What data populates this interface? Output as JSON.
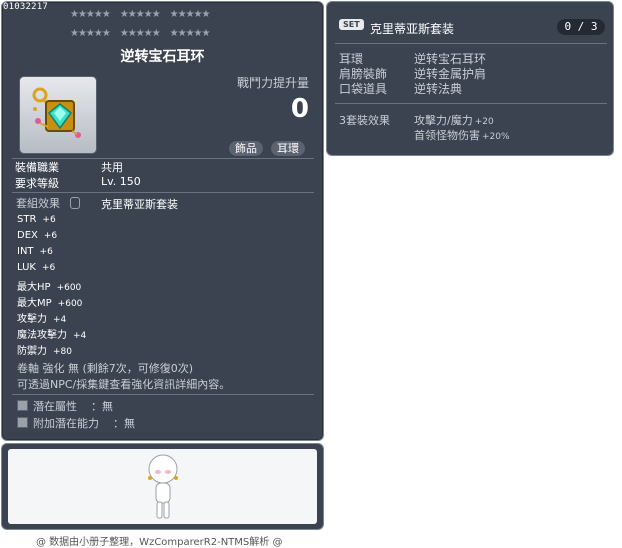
{
  "item": {
    "id": "01032217",
    "stars_top": [
      "★★★★★",
      "★★★★★",
      "★★★★★"
    ],
    "stars_bottom": [
      "★★★★★",
      "★★★★★",
      "★★★★★"
    ],
    "name": "逆转宝石耳环",
    "icon": "gem-earring-icon",
    "power_label": "戰鬥力提升量",
    "power_value": "0",
    "tags": [
      "飾品",
      "耳環"
    ],
    "job_label": "裝備職業",
    "job_value": "共用",
    "level_label": "要求等級",
    "level_value": "Lv. 150",
    "set_effect_label": "套組效果",
    "set_effect_name": "克里蒂亚斯套装",
    "stats": [
      {
        "label": "STR",
        "value": "+6"
      },
      {
        "label": "DEX",
        "value": "+6"
      },
      {
        "label": "INT",
        "value": "+6"
      },
      {
        "label": "LUK",
        "value": "+6"
      },
      {
        "label": "最大HP",
        "value": "+600"
      },
      {
        "label": "最大MP",
        "value": "+600"
      },
      {
        "label": "攻擊力",
        "value": "+4"
      },
      {
        "label": "魔法攻擊力",
        "value": "+4"
      },
      {
        "label": "防禦力",
        "value": "+80"
      }
    ],
    "scroll_line": "卷軸 強化 無 (剩餘7次，可修復0次)",
    "npc_line": "可透過NPC/採集鍵查看強化資訊詳細內容。",
    "potential_label": "潛在屬性",
    "potential_value": "：無",
    "bonus_potential_label": "附加潛在能力",
    "bonus_potential_value": "：無"
  },
  "footer": {
    "credit": "@ 数据由小册子整理，WzComparerR2-NTMS解析 @"
  },
  "set": {
    "badge": "SET",
    "title": "克里蒂亚斯套装",
    "count": "0 / 3",
    "items": [
      {
        "slot": "耳環",
        "name": "逆转宝石耳环"
      },
      {
        "slot": "肩膀裝飾",
        "name": "逆转金属护肩"
      },
      {
        "slot": "口袋道具",
        "name": "逆转法典"
      }
    ],
    "bonus_label": "3套裝效果",
    "bonuses": [
      {
        "label": "攻擊力/魔力",
        "value": "+20"
      },
      {
        "label": "首领怪物伤害",
        "value": "+20%"
      }
    ]
  },
  "colors": {
    "panel_bg": "#3c4350",
    "panel_border": "#7c8593",
    "text": "#ffffff",
    "text_muted": "#c9ced6"
  }
}
